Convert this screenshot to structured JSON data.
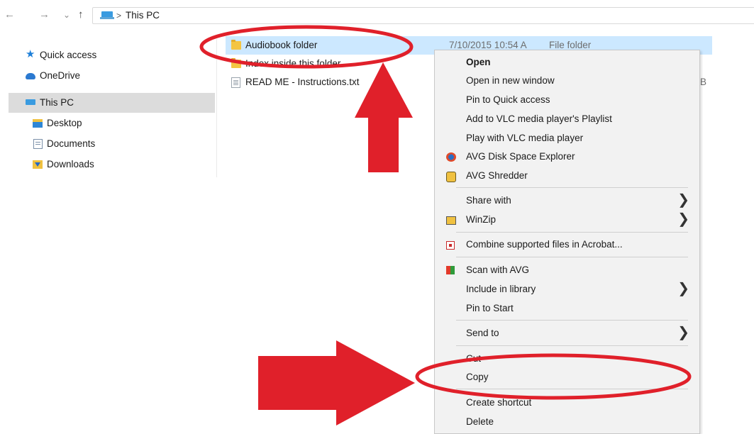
{
  "address": {
    "back_glyph": "←",
    "forward_glyph": "→",
    "recent_glyph": "⌄",
    "up_glyph": "↑",
    "separator": ">",
    "location": "This PC"
  },
  "nav": {
    "items": [
      {
        "label": "Quick access",
        "icon": "star-icon"
      },
      {
        "label": "OneDrive",
        "icon": "cloud-icon"
      },
      {
        "label": "This PC",
        "icon": "this-pc-icon",
        "selected": true
      },
      {
        "label": "Desktop",
        "icon": "desktop-folder-icon"
      },
      {
        "label": "Documents",
        "icon": "documents-folder-icon"
      },
      {
        "label": "Downloads",
        "icon": "downloads-folder-icon"
      }
    ]
  },
  "files": [
    {
      "name": "Audiobook folder",
      "date": "7/10/2015 10:54 A",
      "type": "File folder",
      "size": "",
      "selected": true
    },
    {
      "name": "Index inside this folder",
      "date": "",
      "type": "",
      "size": ""
    },
    {
      "name": "READ ME - Instructions.txt",
      "date": "",
      "type": "",
      "size": "KB"
    }
  ],
  "context_menu": {
    "items": [
      {
        "label": "Open",
        "bold": true
      },
      {
        "label": "Open in new window"
      },
      {
        "label": "Pin to Quick access"
      },
      {
        "label": "Add to VLC media player's Playlist"
      },
      {
        "label": "Play with VLC media player"
      },
      {
        "label": "AVG Disk Space Explorer",
        "icon": "avg-disk-icon"
      },
      {
        "label": "AVG Shredder",
        "icon": "avg-shredder-icon"
      },
      {
        "label": "Share with",
        "submenu": true
      },
      {
        "label": "WinZip",
        "icon": "winzip-icon",
        "submenu": true
      },
      {
        "label": "Combine supported files in Acrobat...",
        "icon": "acrobat-icon"
      },
      {
        "label": "Scan with AVG",
        "icon": "avg-scan-icon"
      },
      {
        "label": "Include in library",
        "submenu": true
      },
      {
        "label": "Pin to Start"
      },
      {
        "label": "Send to",
        "submenu": true
      },
      {
        "label": "Cut"
      },
      {
        "label": "Copy"
      },
      {
        "label": "Create shortcut"
      },
      {
        "label": "Delete"
      }
    ],
    "submenu_glyph": "❯"
  },
  "colors": {
    "selection": "#cce8ff",
    "annotation_red": "#e0202a"
  }
}
